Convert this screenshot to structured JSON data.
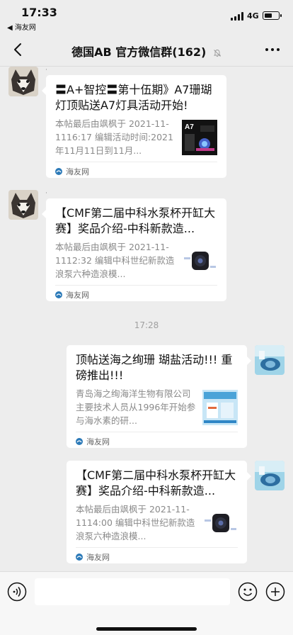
{
  "status_bar": {
    "time": "17:33",
    "back_app": "◀ 海友网",
    "network": "4G",
    "battery_level": 0.6
  },
  "nav": {
    "title": "德国AB 官方微信群(162)"
  },
  "messages": [
    {
      "sender_mark": "·",
      "title": "〓A+智控〓第十伍期》A7珊瑚灯顶贴送A7灯具活动开始!",
      "desc": "本帖最后由飒枫于 2021-11-1116:17 编辑活动时间:2021年11月11日到11月...",
      "source": "海友网",
      "thumb": "a7-lamp-image"
    },
    {
      "sender_mark": "·",
      "title": "【CMF第二届中科水泵杯开缸大赛】奖品介绍-中科新款造...",
      "desc": "本帖最后由飒枫于 2021-11-1112:32 编辑中科世纪新款造浪泵六种造浪模...",
      "source": "海友网",
      "thumb": "wave-pump-image"
    },
    {
      "title": "顶帖送海之绚珊 瑚盐活动!!! 重磅推出!!!",
      "desc": "青岛海之绚海洋生物有限公司主要技术人员从1996年开始参与海水素的研...",
      "source": "海友网",
      "thumb": "coral-salt-image"
    },
    {
      "title": "【CMF第二届中科水泵杯开缸大赛】奖品介绍-中科新款造...",
      "desc": "本帖最后由飒枫于 2021-11-1114:00 编辑中科世纪新款造浪泵六种造浪模...",
      "source": "海友网",
      "thumb": "wave-pump-image"
    }
  ],
  "time_divider": "17:28",
  "icons": {
    "back": "chevron-left-icon",
    "mute": "mute-bell-icon",
    "more": "more-dots-icon",
    "voice": "voice-icon",
    "emoji": "emoji-icon",
    "plus": "plus-icon"
  }
}
